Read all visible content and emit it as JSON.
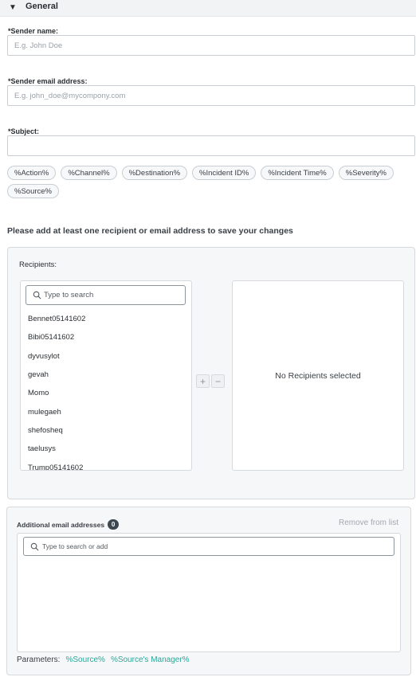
{
  "section": {
    "title": "General"
  },
  "sender_name": {
    "label": "*Sender name:",
    "placeholder": "E.g. John Doe",
    "value": ""
  },
  "sender_email": {
    "label": "*Sender email address:",
    "placeholder": "E.g. john_doe@mycompony.com",
    "value": ""
  },
  "subject": {
    "label": "*Subject:",
    "placeholder": "",
    "value": ""
  },
  "placeholders": [
    "%Action%",
    "%Channel%",
    "%Destination%",
    "%Incident ID%",
    "%Incident Time%",
    "%Severity%",
    "%Source%"
  ],
  "notice": "Please add at least one recipient or email address to save your changes",
  "recipients": {
    "label": "Recipients:",
    "search_placeholder": "Type to search",
    "items": [
      "Bennet05141602",
      "Bibi05141602",
      "dyvusylot",
      "gevah",
      "Momo",
      "mulegaeh",
      "shefosheq",
      "taelusys",
      "Trump05141602"
    ],
    "add_symbol": "+",
    "remove_symbol": "−",
    "empty_text": "No Recipients selected"
  },
  "additional_emails": {
    "label": "Additional email addresses",
    "count": "0",
    "remove_label": "Remove from list",
    "search_placeholder": "Type to search or add",
    "parameters_label": "Parameters:",
    "parameters": [
      "%Source%",
      "%Source's Manager%"
    ]
  },
  "colors": {
    "accent": "#2ea597",
    "badge": "#3d4750",
    "panel_bg": "#f6f7f9"
  }
}
